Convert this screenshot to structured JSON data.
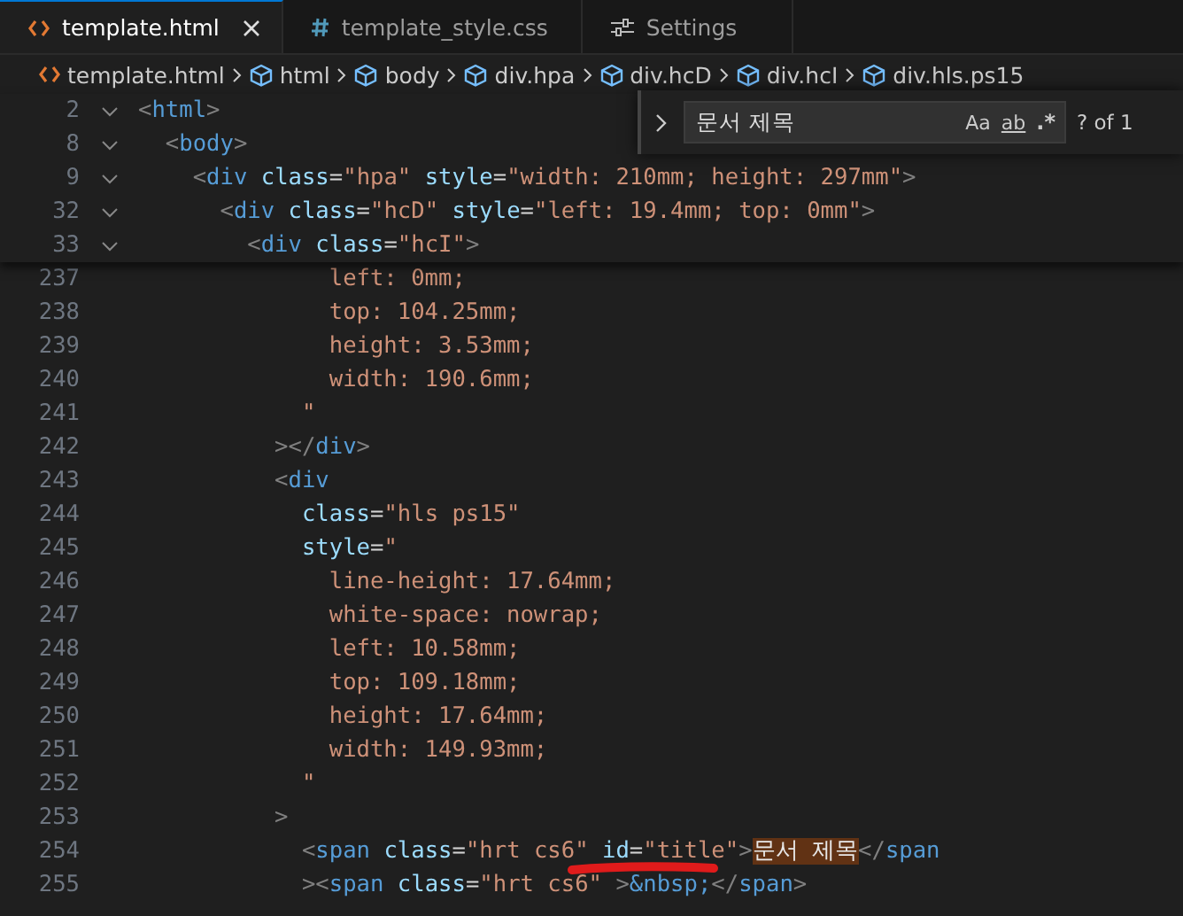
{
  "tabs": [
    {
      "label": "template.html",
      "kind": "html",
      "selected": true
    },
    {
      "label": "template_style.css",
      "kind": "css",
      "selected": false
    },
    {
      "label": "Settings",
      "kind": "settings",
      "selected": false
    }
  ],
  "breadcrumbs": [
    {
      "label": "template.html",
      "kind": "file"
    },
    {
      "label": "html",
      "kind": "element"
    },
    {
      "label": "body",
      "kind": "element"
    },
    {
      "label": "div.hpa",
      "kind": "element"
    },
    {
      "label": "div.hcD",
      "kind": "element"
    },
    {
      "label": "div.hcI",
      "kind": "element"
    },
    {
      "label": "div.hls.ps15",
      "kind": "element"
    }
  ],
  "find_widget": {
    "query": "문서 제목",
    "options": [
      "Aa",
      "ab",
      ".*"
    ],
    "result": "? of 1"
  },
  "sticky_lines": [
    {
      "number": "2",
      "segments": [
        {
          "kind": "punct",
          "text": "<"
        },
        {
          "kind": "tag",
          "text": "html"
        },
        {
          "kind": "punct",
          "text": ">"
        }
      ]
    },
    {
      "number": "8",
      "segments": [
        {
          "kind": "punct",
          "text": "  <"
        },
        {
          "kind": "tag",
          "text": "body"
        },
        {
          "kind": "punct",
          "text": ">"
        }
      ]
    },
    {
      "number": "9",
      "segments": [
        {
          "kind": "punct",
          "text": "    <"
        },
        {
          "kind": "tag",
          "text": "div"
        },
        {
          "kind": "attr",
          "text": " class"
        },
        {
          "kind": "text",
          "text": "="
        },
        {
          "kind": "str",
          "text": "\"hpa\""
        },
        {
          "kind": "attr",
          "text": " style"
        },
        {
          "kind": "text",
          "text": "="
        },
        {
          "kind": "str",
          "text": "\"width: 210mm; height: 297mm\""
        },
        {
          "kind": "punct",
          "text": ">"
        }
      ]
    },
    {
      "number": "32",
      "segments": [
        {
          "kind": "punct",
          "text": "      <"
        },
        {
          "kind": "tag",
          "text": "div"
        },
        {
          "kind": "attr",
          "text": " class"
        },
        {
          "kind": "text",
          "text": "="
        },
        {
          "kind": "str",
          "text": "\"hcD\""
        },
        {
          "kind": "attr",
          "text": " style"
        },
        {
          "kind": "text",
          "text": "="
        },
        {
          "kind": "str",
          "text": "\"left: 19.4mm; top: 0mm\""
        },
        {
          "kind": "punct",
          "text": ">"
        }
      ]
    },
    {
      "number": "33",
      "segments": [
        {
          "kind": "punct",
          "text": "        <"
        },
        {
          "kind": "tag",
          "text": "div"
        },
        {
          "kind": "attr",
          "text": " class"
        },
        {
          "kind": "text",
          "text": "="
        },
        {
          "kind": "str",
          "text": "\"hcI\""
        },
        {
          "kind": "punct",
          "text": ">"
        }
      ]
    }
  ],
  "lines": [
    {
      "number": "237",
      "segments": [
        {
          "kind": "str",
          "text": "              left: 0mm;"
        }
      ]
    },
    {
      "number": "238",
      "segments": [
        {
          "kind": "str",
          "text": "              top: 104.25mm;"
        }
      ]
    },
    {
      "number": "239",
      "segments": [
        {
          "kind": "str",
          "text": "              height: 3.53mm;"
        }
      ]
    },
    {
      "number": "240",
      "segments": [
        {
          "kind": "str",
          "text": "              width: 190.6mm;"
        }
      ]
    },
    {
      "number": "241",
      "segments": [
        {
          "kind": "str",
          "text": "            \""
        }
      ]
    },
    {
      "number": "242",
      "segments": [
        {
          "kind": "punct",
          "text": "          ></"
        },
        {
          "kind": "tag",
          "text": "div"
        },
        {
          "kind": "punct",
          "text": ">"
        }
      ]
    },
    {
      "number": "243",
      "segments": [
        {
          "kind": "punct",
          "text": "          <"
        },
        {
          "kind": "tag",
          "text": "div"
        }
      ]
    },
    {
      "number": "244",
      "segments": [
        {
          "kind": "attr",
          "text": "            class"
        },
        {
          "kind": "text",
          "text": "="
        },
        {
          "kind": "str",
          "text": "\"hls ps15\""
        }
      ]
    },
    {
      "number": "245",
      "segments": [
        {
          "kind": "attr",
          "text": "            style"
        },
        {
          "kind": "text",
          "text": "="
        },
        {
          "kind": "str",
          "text": "\""
        }
      ]
    },
    {
      "number": "246",
      "segments": [
        {
          "kind": "str",
          "text": "              line-height: 17.64mm;"
        }
      ]
    },
    {
      "number": "247",
      "segments": [
        {
          "kind": "str",
          "text": "              white-space: nowrap;"
        }
      ]
    },
    {
      "number": "248",
      "segments": [
        {
          "kind": "str",
          "text": "              left: 10.58mm;"
        }
      ]
    },
    {
      "number": "249",
      "segments": [
        {
          "kind": "str",
          "text": "              top: 109.18mm;"
        }
      ]
    },
    {
      "number": "250",
      "segments": [
        {
          "kind": "str",
          "text": "              height: 17.64mm;"
        }
      ]
    },
    {
      "number": "251",
      "segments": [
        {
          "kind": "str",
          "text": "              width: 149.93mm;"
        }
      ]
    },
    {
      "number": "252",
      "segments": [
        {
          "kind": "str",
          "text": "            \""
        }
      ]
    },
    {
      "number": "253",
      "segments": [
        {
          "kind": "punct",
          "text": "          >"
        }
      ]
    },
    {
      "number": "254",
      "segments": [
        {
          "kind": "punct",
          "text": "            <"
        },
        {
          "kind": "tag",
          "text": "span"
        },
        {
          "kind": "attr",
          "text": " class"
        },
        {
          "kind": "text",
          "text": "="
        },
        {
          "kind": "str",
          "text": "\"hrt cs6\""
        },
        {
          "kind": "attr",
          "text": " id"
        },
        {
          "kind": "text",
          "text": "="
        },
        {
          "kind": "str",
          "text": "\"title\""
        },
        {
          "kind": "punct",
          "text": ">"
        },
        {
          "kind": "match",
          "text": "문서 제목"
        },
        {
          "kind": "punct",
          "text": "</"
        },
        {
          "kind": "tag",
          "text": "span"
        }
      ]
    },
    {
      "number": "255",
      "segments": [
        {
          "kind": "punct",
          "text": "            ><"
        },
        {
          "kind": "tag",
          "text": "span"
        },
        {
          "kind": "attr",
          "text": " class"
        },
        {
          "kind": "text",
          "text": "="
        },
        {
          "kind": "str",
          "text": "\"hrt cs6\""
        },
        {
          "kind": "punct",
          "text": " >"
        },
        {
          "kind": "tag",
          "text": "&nbsp;"
        },
        {
          "kind": "punct",
          "text": "</"
        },
        {
          "kind": "tag",
          "text": "span"
        },
        {
          "kind": "punct",
          "text": ">"
        }
      ]
    }
  ]
}
